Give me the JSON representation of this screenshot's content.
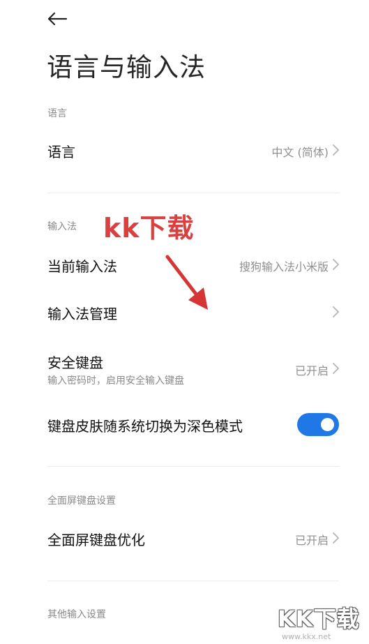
{
  "header": {
    "back_icon": "arrow-left-icon",
    "title": "语言与输入法"
  },
  "sections": {
    "language": {
      "label": "语言",
      "row": {
        "title": "语言",
        "value": "中文 (简体)"
      }
    },
    "input_method": {
      "label": "输入法",
      "current": {
        "title": "当前输入法",
        "value": "搜狗输入法小米版"
      },
      "manage": {
        "title": "输入法管理"
      },
      "secure_keyboard": {
        "title": "安全键盘",
        "subtitle": "输入密码时，启用安全输入键盘",
        "value": "已开启"
      },
      "dark_skin": {
        "title": "键盘皮肤随系统切换为深色模式",
        "toggle_on": true
      }
    },
    "fullscreen": {
      "label": "全面屏键盘设置",
      "optimize": {
        "title": "全面屏键盘优化",
        "value": "已开启"
      }
    },
    "other": {
      "label": "其他输入设置"
    }
  },
  "watermark": {
    "text": "kk下载",
    "logo": "KK下载",
    "url": "www.kkx.net"
  },
  "colors": {
    "toggle_on": "#1f78e6",
    "watermark_red": "#d94141",
    "secondary_text": "#8a8a8a"
  }
}
